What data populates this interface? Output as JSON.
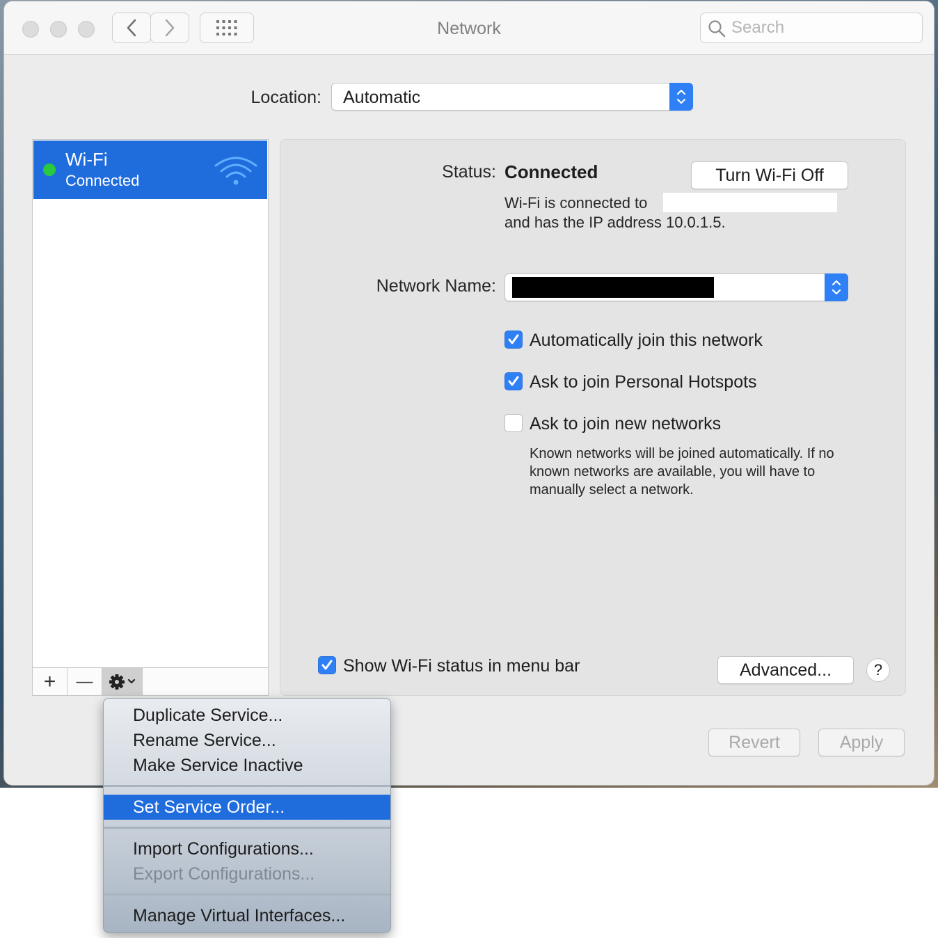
{
  "window": {
    "title": "Network"
  },
  "toolbar": {
    "back_icon": "chevron-left-icon",
    "forward_icon": "chevron-right-icon",
    "grid_icon": "grid-icon",
    "search_placeholder": "Search",
    "search_value": ""
  },
  "location": {
    "label": "Location:",
    "value": "Automatic"
  },
  "sidebar": {
    "services": [
      {
        "name": "Wi-Fi",
        "status": "Connected",
        "status_color": "#2ac940"
      }
    ],
    "add_label": "+",
    "remove_label": "—",
    "gear_icon": "gear-icon"
  },
  "detail": {
    "status_label": "Status:",
    "status_value": "Connected",
    "turn_off_button": "Turn Wi-Fi Off",
    "connected_text_1": "Wi-Fi is connected to",
    "connected_text_2": "and has the IP address 10.0.1.5.",
    "network_name_label": "Network Name:",
    "network_name_value": "",
    "checkboxes": [
      {
        "label": "Automatically join this network",
        "checked": true
      },
      {
        "label": "Ask to join Personal Hotspots",
        "checked": true
      },
      {
        "label": "Ask to join new networks",
        "checked": false
      }
    ],
    "help_text": "Known networks will be joined automatically. If no known networks are available, you will have to manually select a network.",
    "show_status_label": "Show Wi-Fi status in menu bar",
    "show_status_checked": true,
    "advanced_button": "Advanced...",
    "help_button": "?"
  },
  "footer": {
    "revert_button": "Revert",
    "apply_button": "Apply"
  },
  "menu": {
    "items": [
      {
        "label": "Duplicate Service...",
        "enabled": true
      },
      {
        "label": "Rename Service...",
        "enabled": true
      },
      {
        "label": "Make Service Inactive",
        "enabled": true
      },
      {
        "label": "Set Service Order...",
        "enabled": true,
        "highlighted": true
      },
      {
        "label": "Import Configurations...",
        "enabled": true
      },
      {
        "label": "Export Configurations...",
        "enabled": false
      },
      {
        "label": "Manage Virtual Interfaces...",
        "enabled": true
      }
    ]
  },
  "colors": {
    "accent": "#2f7ff5",
    "selection": "#1f6cdd"
  }
}
